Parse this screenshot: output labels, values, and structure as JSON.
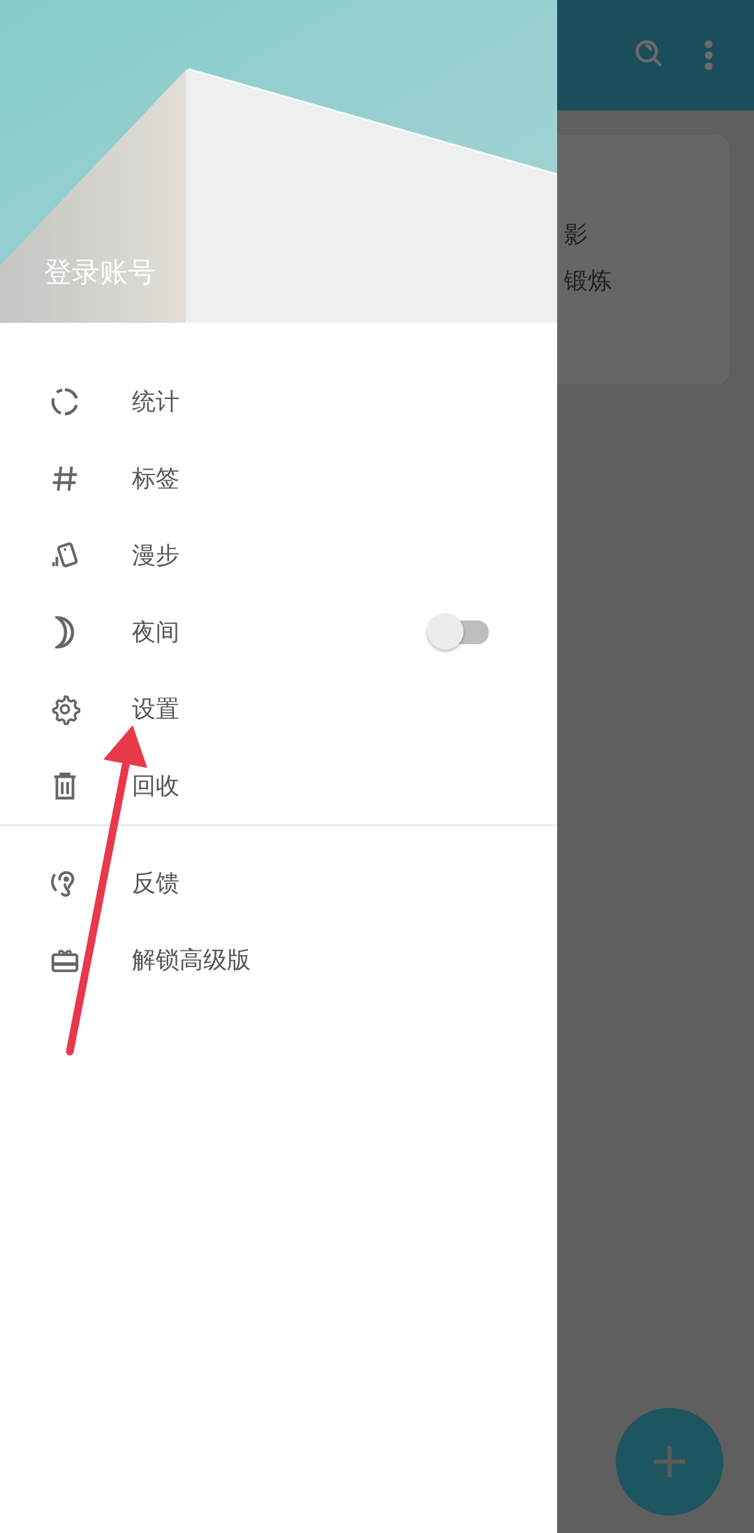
{
  "drawer": {
    "account_label": "登录账号",
    "sections": [
      {
        "items": [
          {
            "label": "统计",
            "kind": "link"
          },
          {
            "label": "标签",
            "kind": "link"
          },
          {
            "label": "漫步",
            "kind": "link"
          },
          {
            "label": "夜间",
            "kind": "switch",
            "on": false
          },
          {
            "label": "设置",
            "kind": "link"
          },
          {
            "label": "回收",
            "kind": "link"
          }
        ]
      },
      {
        "items": [
          {
            "label": "反馈",
            "kind": "link"
          },
          {
            "label": "解锁高级版",
            "kind": "link"
          }
        ]
      }
    ]
  },
  "note_card": {
    "lines": [
      "影",
      "锻炼"
    ]
  }
}
